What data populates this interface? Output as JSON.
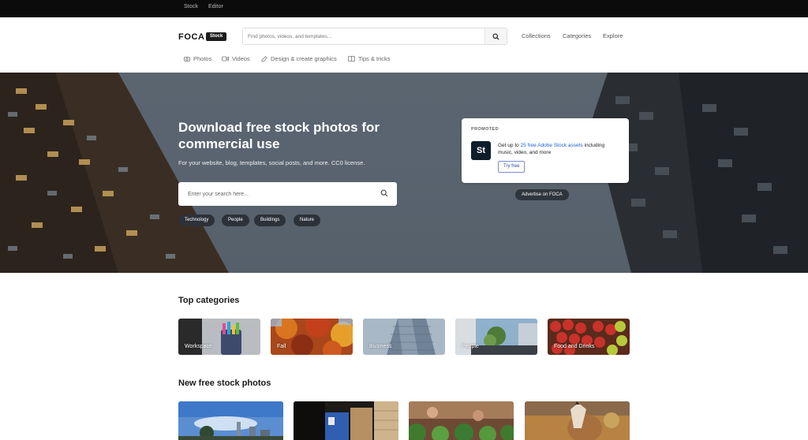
{
  "topbar": {
    "links": [
      "Stock",
      "Editor"
    ]
  },
  "header": {
    "logo": "FOCA",
    "badge": "Stock",
    "search_placeholder": "Find photos, videos, and templates...",
    "nav": [
      "Collections",
      "Categories",
      "Explore"
    ],
    "subnav": [
      {
        "label": "Photos",
        "icon": "camera-icon"
      },
      {
        "label": "Videos",
        "icon": "video-icon"
      },
      {
        "label": "Design & create graphics",
        "icon": "design-icon"
      },
      {
        "label": "Tips & tricks",
        "icon": "book-icon"
      }
    ]
  },
  "hero": {
    "title": "Download free stock photos for commercial use",
    "subtitle": "For your website, blog, templates, social posts, and more. CC0 license.",
    "search_placeholder": "Enter your search here...",
    "chips": [
      "Technology",
      "People",
      "Buildings",
      "Nature"
    ]
  },
  "promo": {
    "label": "PROMOTED",
    "logo": "St",
    "text_before": "Get up to ",
    "link": "25 free Adobe Stock assets",
    "text_after": " including music, video, and more",
    "button": "Try free",
    "advertise": "Advertise on FOCA"
  },
  "categories": {
    "title": "Top categories",
    "items": [
      {
        "label": "Workspace",
        "color": "#9aa0a8"
      },
      {
        "label": "Fall",
        "color": "#b5521c"
      },
      {
        "label": "Business",
        "color": "#7e8ea0"
      },
      {
        "label": "People",
        "color": "#7da0b8"
      },
      {
        "label": "Food and Drinks",
        "color": "#a8382f"
      }
    ]
  },
  "photos": {
    "title": "New free stock photos"
  }
}
